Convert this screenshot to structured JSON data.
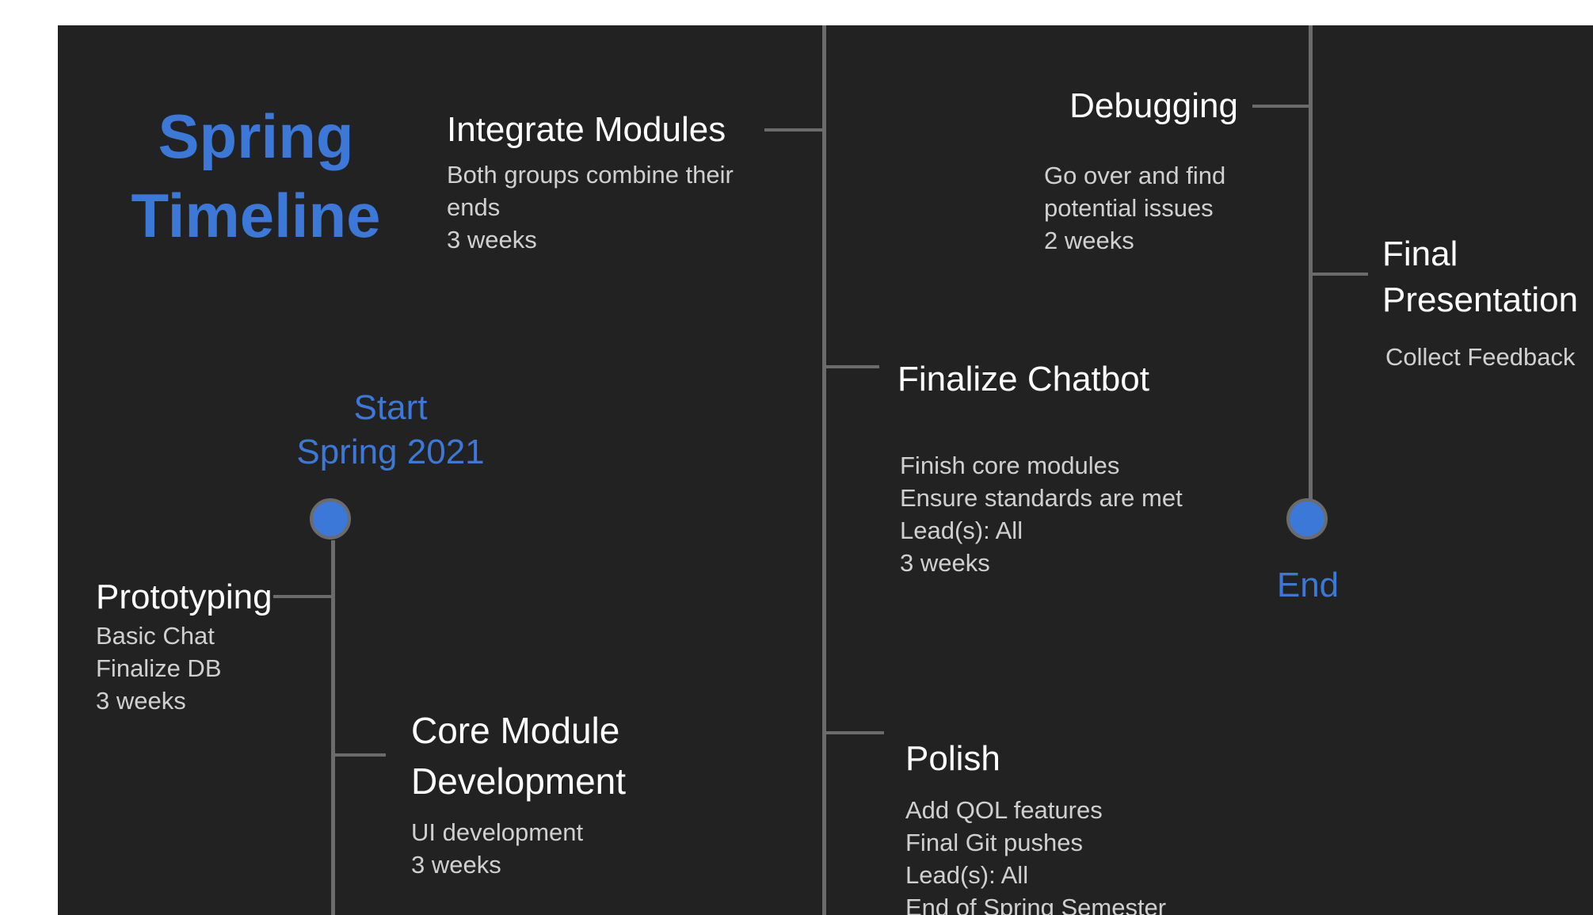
{
  "title": {
    "line1": "Spring",
    "line2": "Timeline"
  },
  "start": {
    "line1": "Start",
    "line2": "Spring 2021"
  },
  "end": {
    "label": "End"
  },
  "colors": {
    "background": "#222222",
    "accent": "#3c78d8",
    "line": "#6b6b6b",
    "heading": "#ffffff",
    "body": "#d0d0d0"
  },
  "milestones": [
    {
      "title": "Prototyping",
      "details": [
        "Basic Chat",
        "Finalize DB",
        "3 weeks"
      ]
    },
    {
      "title": "Core Module Development",
      "details": [
        "UI development",
        "3 weeks"
      ]
    },
    {
      "title": "Integrate Modules",
      "details": [
        "Both groups combine their ends",
        "3 weeks"
      ]
    },
    {
      "title": "Finalize Chatbot",
      "details": [
        "Finish core modules",
        "Ensure standards are met",
        "Lead(s): All",
        "3 weeks"
      ]
    },
    {
      "title": "Polish",
      "details": [
        "Add QOL features",
        "Final Git pushes",
        "Lead(s): All",
        "End of Spring Semester"
      ]
    },
    {
      "title": "Debugging",
      "details": [
        "Go over and find potential issues",
        "2 weeks"
      ]
    },
    {
      "title": "Final Presentation",
      "details": [
        "Collect Feedback"
      ]
    }
  ]
}
